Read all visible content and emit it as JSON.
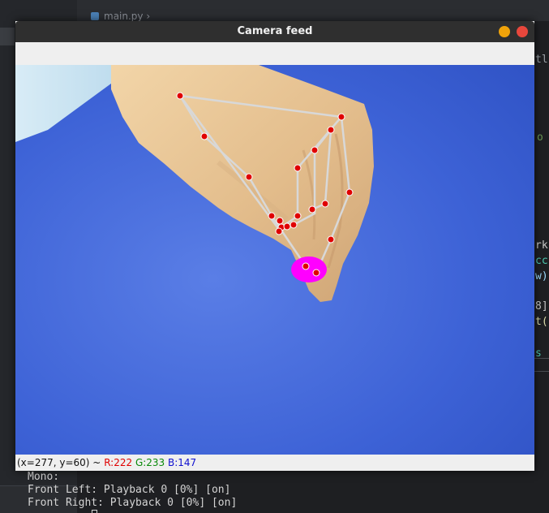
{
  "ide": {
    "tab_label": "main.py",
    "code_fragments": [
      "tl",
      "o",
      "rk",
      "cc",
      "w)",
      "8]",
      "t(",
      "s"
    ]
  },
  "terminal": {
    "lines": [
      "Mono:",
      "Front Left: Playback 0 [0%] [on]",
      "Front Right: Playback 0 [0%] [on]"
    ]
  },
  "window": {
    "title": "Camera feed",
    "minimize_color": "#f0a30a",
    "close_color": "#e8473c"
  },
  "status": {
    "coords": "(x=277, y=60) ~",
    "r": "R:222",
    "g": "G:233",
    "b": "B:147"
  },
  "feed": {
    "background_color": "#3f63d8",
    "landmark_color": "#e00000",
    "connection_color": "#d8d8d8",
    "pinch_marker_color": "#ff00ff"
  }
}
